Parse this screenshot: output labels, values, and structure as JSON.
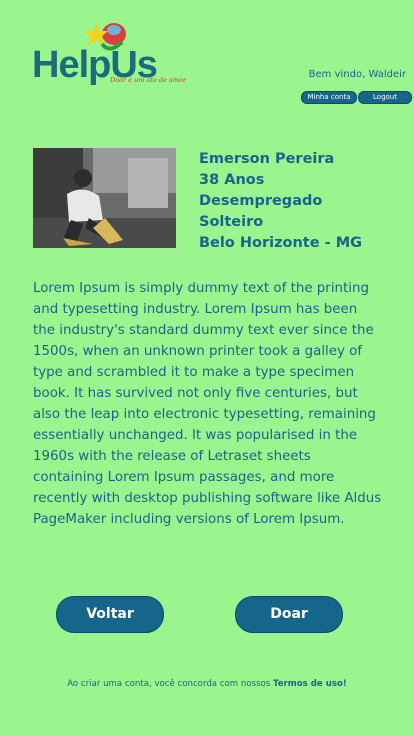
{
  "brand": {
    "name": "HelpUs",
    "tagline": "Doar é um ato de amor"
  },
  "header": {
    "welcome": "Bem vindo, Waldeir",
    "account_label": "Minha conta",
    "logout_label": "Logout"
  },
  "profile": {
    "name": "Emerson Pereira",
    "age": "38 Anos",
    "employment": "Desempregado",
    "marital_status": "Solteiro",
    "location": "Belo Horizonte - MG"
  },
  "description": "Lorem Ipsum is simply dummy text of the printing and typesetting industry. Lorem Ipsum has been the industry's standard dummy text ever since the 1500s, when an unknown printer took a galley of type and scrambled it to make a type specimen book. It has survived not only five centuries, but also the leap into electronic typesetting, remaining essentially unchanged. It was popularised in the 1960s with the release of Letraset sheets containing Lorem Ipsum passages, and more recently with desktop publishing software like Aldus PageMaker including versions of Lorem Ipsum.",
  "actions": {
    "back_label": "Voltar",
    "donate_label": "Doar"
  },
  "footer": {
    "text": "Ao criar uma conta, você concorda com nossos",
    "terms_label": "Termos de uso!"
  },
  "colors": {
    "background": "#9bf58f",
    "primary": "#16658a",
    "logo_text": "#1a6c7c",
    "tagline": "#d83a2a"
  }
}
